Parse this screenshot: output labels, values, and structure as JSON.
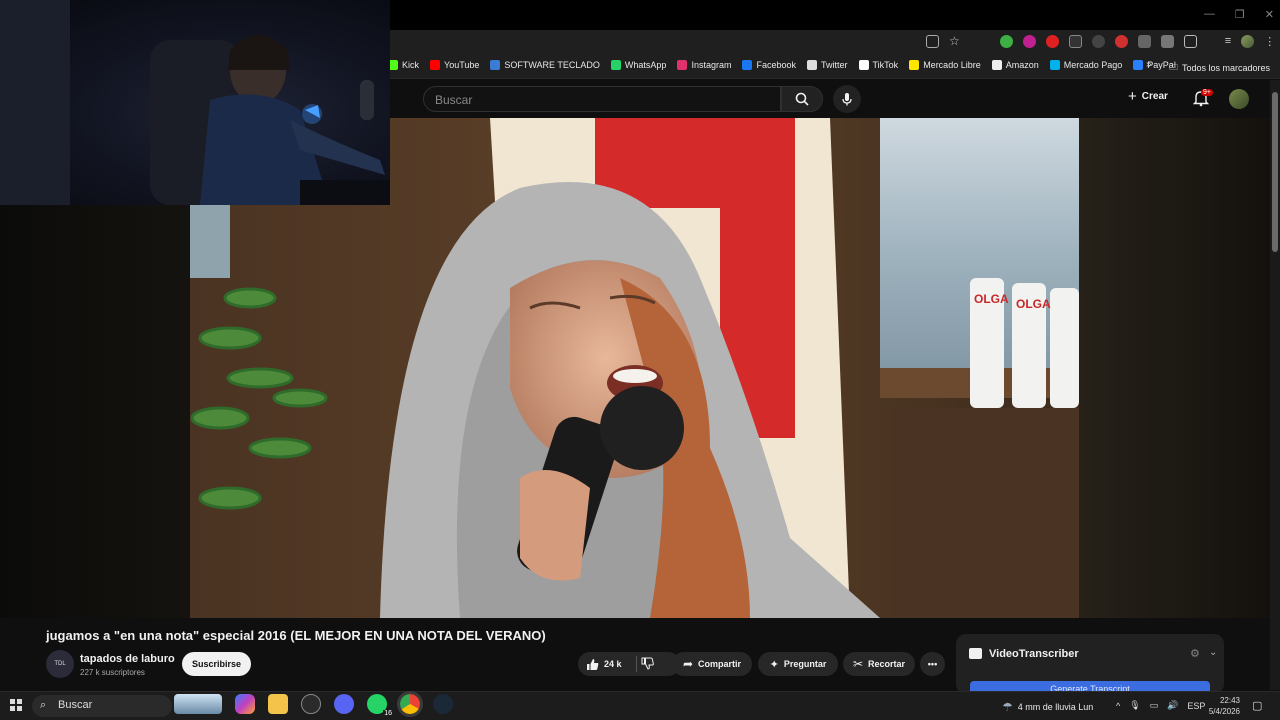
{
  "browser": {
    "bookmarks": [
      {
        "label": "Kick",
        "color": "#53fc18"
      },
      {
        "label": "YouTube",
        "color": "#ff0000"
      },
      {
        "label": "SOFTWARE TECLADO",
        "color": "#3a7bd5"
      },
      {
        "label": "WhatsApp",
        "color": "#25d366"
      },
      {
        "label": "Instagram",
        "color": "#e1306c"
      },
      {
        "label": "Facebook",
        "color": "#1877f2"
      },
      {
        "label": "Twitter",
        "color": "#dddddd"
      },
      {
        "label": "TikTok",
        "color": "#ffffff"
      },
      {
        "label": "Mercado Libre",
        "color": "#ffe600"
      },
      {
        "label": "Amazon",
        "color": "#eeeeee"
      },
      {
        "label": "Mercado Pago",
        "color": "#00b1ea"
      },
      {
        "label": "PayPal",
        "color": "#2a7fff"
      }
    ],
    "all_bookmarks": "Todos los marcadores",
    "more_icon": "»"
  },
  "youtube": {
    "search_placeholder": "Buscar",
    "create_label": "Crear",
    "notification_count": "9+",
    "video": {
      "title": "jugamos a \"en una nota\" especial 2016 (EL MEJOR EN UNA NOTA DEL VERANO)",
      "channel_name": "tapados de laburo",
      "channel_avatar_text": "TDL",
      "subscribers": "227 k suscriptores",
      "subscribe_label": "Suscribirse",
      "likes": "24 k",
      "share_label": "Compartir",
      "ask_label": "Preguntar",
      "clip_label": "Recortar",
      "more_label": "•••"
    },
    "video_transcriber": {
      "title": "VideoTranscriber",
      "generate_label": "Generate Transcript"
    }
  },
  "taskbar": {
    "search_label": "Buscar",
    "whatsapp_badge": "16",
    "weather": "4 mm de lluvia Lun",
    "language": "ESP",
    "time": "22:43",
    "date": "5/4/2026"
  }
}
